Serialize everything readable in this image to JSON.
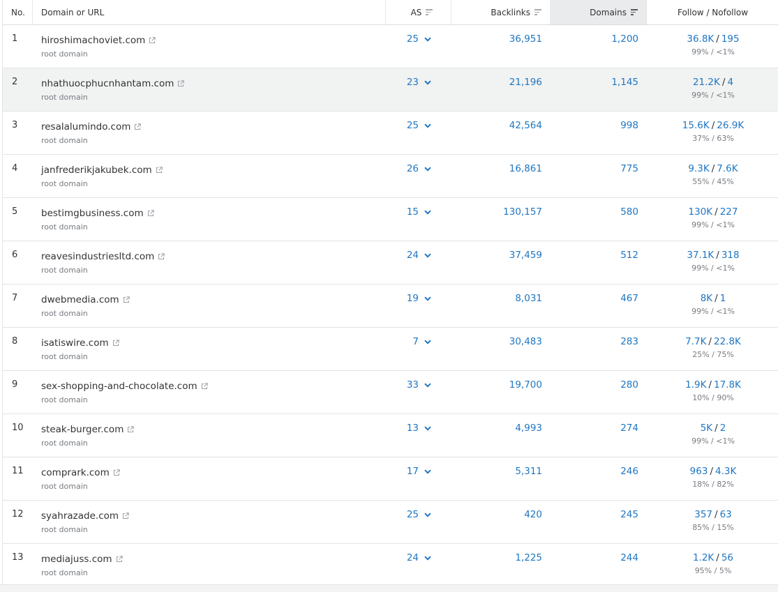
{
  "header": {
    "no": "No.",
    "domain": "Domain or URL",
    "as": "AS",
    "backlinks": "Backlinks",
    "domains": "Domains",
    "follow": "Follow / Nofollow"
  },
  "sorted_column": "domains",
  "colors": {
    "link": "#1e76c2",
    "highlight_row": "#f1f2f2",
    "active_header": "#eaebec"
  },
  "rows": [
    {
      "no": "1",
      "domain": "hiroshimachoviet.com",
      "type": "root domain",
      "as": "25",
      "backlinks": "36,951",
      "domains": "1,200",
      "follow": "36.8K",
      "nofollow": "195",
      "ratio": "99% / <1%"
    },
    {
      "no": "2",
      "domain": "nhathuocphucnhantam.com",
      "type": "root domain",
      "as": "23",
      "backlinks": "21,196",
      "domains": "1,145",
      "follow": "21.2K",
      "nofollow": "4",
      "ratio": "99% / <1%"
    },
    {
      "no": "3",
      "domain": "resalalumindo.com",
      "type": "root domain",
      "as": "25",
      "backlinks": "42,564",
      "domains": "998",
      "follow": "15.6K",
      "nofollow": "26.9K",
      "ratio": "37% / 63%"
    },
    {
      "no": "4",
      "domain": "janfrederikjakubek.com",
      "type": "root domain",
      "as": "26",
      "backlinks": "16,861",
      "domains": "775",
      "follow": "9.3K",
      "nofollow": "7.6K",
      "ratio": "55% / 45%"
    },
    {
      "no": "5",
      "domain": "bestimgbusiness.com",
      "type": "root domain",
      "as": "15",
      "backlinks": "130,157",
      "domains": "580",
      "follow": "130K",
      "nofollow": "227",
      "ratio": "99% / <1%"
    },
    {
      "no": "6",
      "domain": "reavesindustriesltd.com",
      "type": "root domain",
      "as": "24",
      "backlinks": "37,459",
      "domains": "512",
      "follow": "37.1K",
      "nofollow": "318",
      "ratio": "99% / <1%"
    },
    {
      "no": "7",
      "domain": "dwebmedia.com",
      "type": "root domain",
      "as": "19",
      "backlinks": "8,031",
      "domains": "467",
      "follow": "8K",
      "nofollow": "1",
      "ratio": "99% / <1%"
    },
    {
      "no": "8",
      "domain": "isatiswire.com",
      "type": "root domain",
      "as": "7",
      "backlinks": "30,483",
      "domains": "283",
      "follow": "7.7K",
      "nofollow": "22.8K",
      "ratio": "25% / 75%"
    },
    {
      "no": "9",
      "domain": "sex-shopping-and-chocolate.com",
      "type": "root domain",
      "as": "33",
      "backlinks": "19,700",
      "domains": "280",
      "follow": "1.9K",
      "nofollow": "17.8K",
      "ratio": "10% / 90%"
    },
    {
      "no": "10",
      "domain": "steak-burger.com",
      "type": "root domain",
      "as": "13",
      "backlinks": "4,993",
      "domains": "274",
      "follow": "5K",
      "nofollow": "2",
      "ratio": "99% / <1%"
    },
    {
      "no": "11",
      "domain": "comprark.com",
      "type": "root domain",
      "as": "17",
      "backlinks": "5,311",
      "domains": "246",
      "follow": "963",
      "nofollow": "4.3K",
      "ratio": "18% / 82%"
    },
    {
      "no": "12",
      "domain": "syahrazade.com",
      "type": "root domain",
      "as": "25",
      "backlinks": "420",
      "domains": "245",
      "follow": "357",
      "nofollow": "63",
      "ratio": "85% / 15%"
    },
    {
      "no": "13",
      "domain": "mediajuss.com",
      "type": "root domain",
      "as": "24",
      "backlinks": "1,225",
      "domains": "244",
      "follow": "1.2K",
      "nofollow": "56",
      "ratio": "95% / 5%"
    }
  ]
}
